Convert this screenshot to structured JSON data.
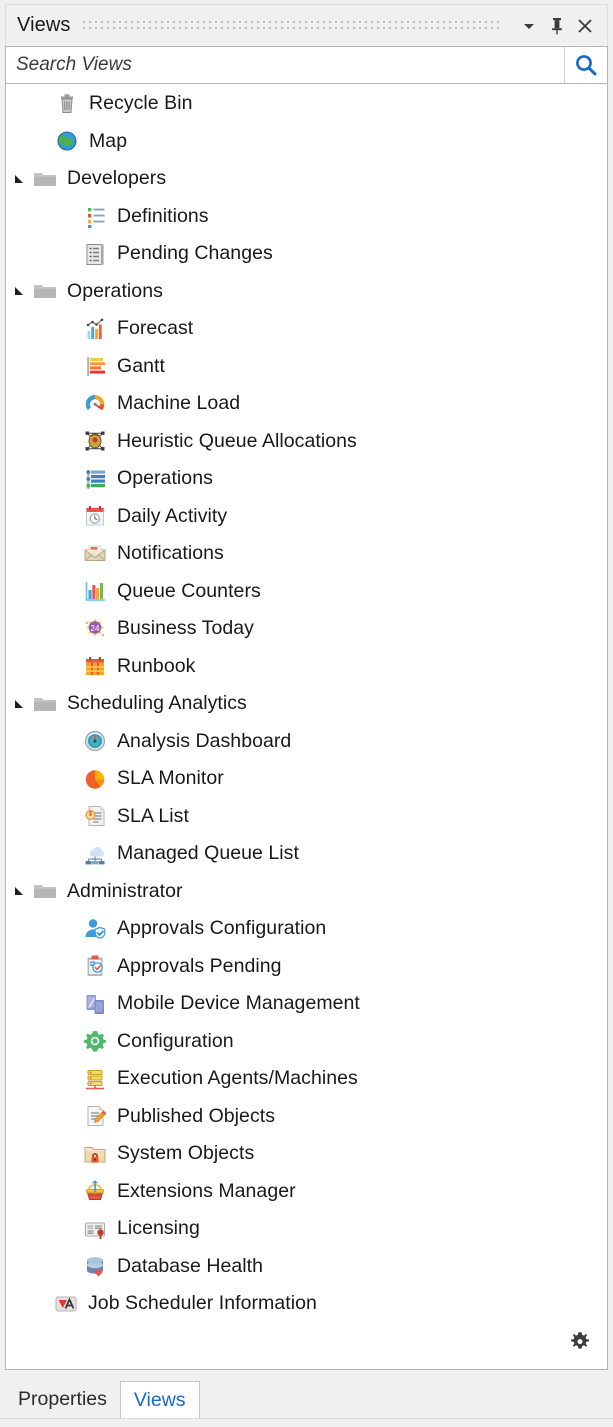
{
  "titlebar": {
    "title": "Views",
    "menu_icon": "chevron-down-icon",
    "pin_icon": "pin-icon",
    "close_icon": "close-icon"
  },
  "search": {
    "placeholder": "Search Views",
    "value": "",
    "button_icon": "search-icon"
  },
  "tree": {
    "items": [
      {
        "label": "Recycle Bin",
        "icon": "recycle-bin-icon",
        "indent": "lvl0",
        "expander": "none"
      },
      {
        "label": "Map",
        "icon": "globe-icon",
        "indent": "lvl0",
        "expander": "none"
      },
      {
        "label": "Developers",
        "icon": "folder-icon",
        "indent": "lvl0f",
        "expander": "expanded"
      },
      {
        "label": "Definitions",
        "icon": "definitions-list-icon",
        "indent": "lvl1",
        "expander": "none"
      },
      {
        "label": "Pending Changes",
        "icon": "pending-changes-icon",
        "indent": "lvl1",
        "expander": "none"
      },
      {
        "label": "Operations",
        "icon": "folder-icon",
        "indent": "lvl0f",
        "expander": "expanded"
      },
      {
        "label": "Forecast",
        "icon": "forecast-chart-icon",
        "indent": "lvl1",
        "expander": "none"
      },
      {
        "label": "Gantt",
        "icon": "gantt-bars-icon",
        "indent": "lvl1",
        "expander": "none"
      },
      {
        "label": "Machine Load",
        "icon": "gauge-icon",
        "indent": "lvl1",
        "expander": "none"
      },
      {
        "label": "Heuristic Queue Allocations",
        "icon": "heuristic-node-icon",
        "indent": "lvl1",
        "expander": "none"
      },
      {
        "label": "Operations",
        "icon": "operations-list-icon",
        "indent": "lvl1",
        "expander": "none"
      },
      {
        "label": "Daily Activity",
        "icon": "calendar-clock-icon",
        "indent": "lvl1",
        "expander": "none"
      },
      {
        "label": "Notifications",
        "icon": "envelope-icon",
        "indent": "lvl1",
        "expander": "none"
      },
      {
        "label": "Queue Counters",
        "icon": "bar-chart-icon",
        "indent": "lvl1",
        "expander": "none"
      },
      {
        "label": "Business Today",
        "icon": "business-today-icon",
        "indent": "lvl1",
        "expander": "none"
      },
      {
        "label": "Runbook",
        "icon": "runbook-grid-icon",
        "indent": "lvl1",
        "expander": "none"
      },
      {
        "label": "Scheduling Analytics",
        "icon": "folder-icon",
        "indent": "lvl0f",
        "expander": "expanded"
      },
      {
        "label": "Analysis Dashboard",
        "icon": "dashboard-dial-icon",
        "indent": "lvl1",
        "expander": "none"
      },
      {
        "label": "SLA Monitor",
        "icon": "pie-chart-icon",
        "indent": "lvl1",
        "expander": "none"
      },
      {
        "label": "SLA List",
        "icon": "sla-document-icon",
        "indent": "lvl1",
        "expander": "none"
      },
      {
        "label": "Managed Queue List",
        "icon": "cloud-network-icon",
        "indent": "lvl1",
        "expander": "none"
      },
      {
        "label": "Administrator",
        "icon": "folder-icon",
        "indent": "lvl0f",
        "expander": "expanded"
      },
      {
        "label": "Approvals Configuration",
        "icon": "user-check-icon",
        "indent": "lvl1",
        "expander": "none"
      },
      {
        "label": "Approvals Pending",
        "icon": "clipboard-check-icon",
        "indent": "lvl1",
        "expander": "none"
      },
      {
        "label": "Mobile Device Management",
        "icon": "mobile-devices-icon",
        "indent": "lvl1",
        "expander": "none"
      },
      {
        "label": "Configuration",
        "icon": "gear-green-icon",
        "indent": "lvl1",
        "expander": "none"
      },
      {
        "label": "Execution Agents/Machines",
        "icon": "server-stack-icon",
        "indent": "lvl1",
        "expander": "none"
      },
      {
        "label": "Published Objects",
        "icon": "document-pencil-icon",
        "indent": "lvl1",
        "expander": "none"
      },
      {
        "label": "System Objects",
        "icon": "folder-lock-icon",
        "indent": "lvl1",
        "expander": "none"
      },
      {
        "label": "Extensions Manager",
        "icon": "extensions-icon",
        "indent": "lvl1",
        "expander": "none"
      },
      {
        "label": "Licensing",
        "icon": "license-card-icon",
        "indent": "lvl1",
        "expander": "none"
      },
      {
        "label": "Database Health",
        "icon": "database-heart-icon",
        "indent": "lvl1",
        "expander": "none"
      },
      {
        "label": "Job Scheduler Information",
        "icon": "job-scheduler-icon",
        "indent": "lvlJob",
        "expander": "none"
      }
    ]
  },
  "footer": {
    "settings_icon": "gear-icon"
  },
  "tabs": [
    {
      "label": "Properties",
      "active": false
    },
    {
      "label": "Views",
      "active": true
    }
  ],
  "colors": {
    "panel_bg": "#f0f0f0",
    "content_bg": "#ffffff",
    "border": "#b4b4b4",
    "text": "#191919",
    "active_tab_text": "#1569c7",
    "search_icon": "#1569c7"
  }
}
